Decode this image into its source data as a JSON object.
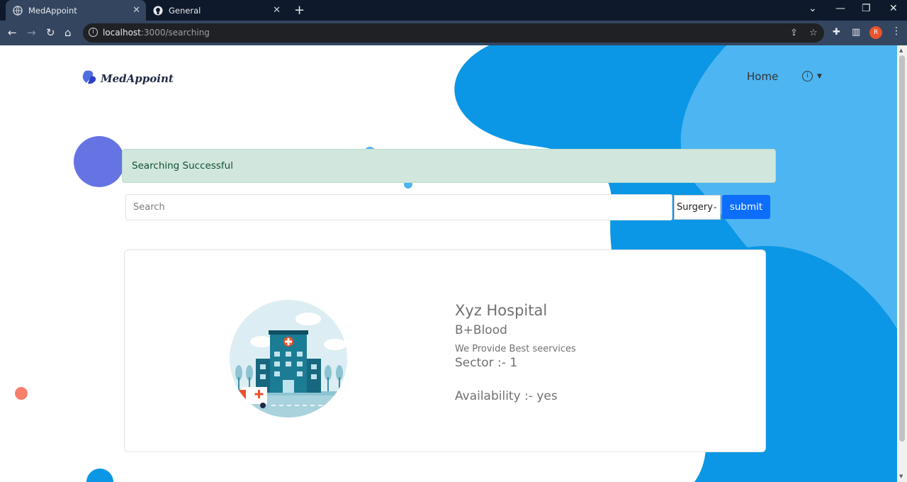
{
  "browser": {
    "tabs": [
      {
        "title": "MedAppoint",
        "icon": "globe-icon"
      },
      {
        "title": "General",
        "icon": "github-icon"
      }
    ],
    "url_host": "localhost",
    "url_path": ":3000/searching",
    "profile_initial": "R"
  },
  "header": {
    "logo_text": "MedAppoint",
    "nav_home": "Home"
  },
  "alert": {
    "message": "Searching Successful",
    "color": "#d1e7dd"
  },
  "search": {
    "placeholder": "Search",
    "value": "",
    "category_selected": "Surgery",
    "submit_label": "submit"
  },
  "result": {
    "name": "Xyz Hospital",
    "blood": "B+Blood",
    "description": "We Provide Best seervices",
    "sector": "Sector :- 1",
    "availability": "Availability :- yes"
  },
  "colors": {
    "accent": "#0d6efd",
    "blob_primary": "#0b97e5",
    "blob_light": "#4db5f1"
  }
}
